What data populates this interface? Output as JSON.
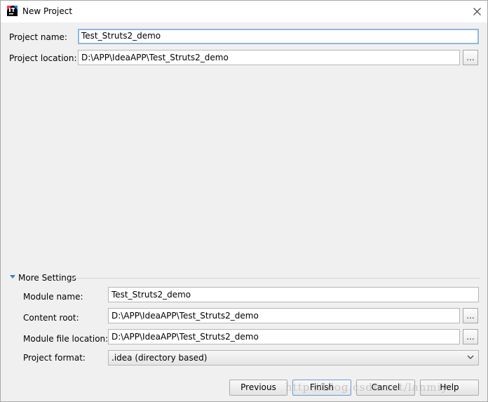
{
  "window": {
    "title": "New Project"
  },
  "project_name": {
    "label": "Project name:",
    "value": "Test_Struts2_demo"
  },
  "project_location": {
    "label": "Project location:",
    "value": "D:\\APP\\IdeaAPP\\Test_Struts2_demo",
    "browse": "..."
  },
  "more_settings": {
    "label": "More Settings"
  },
  "module_name": {
    "label": "Module name:",
    "value": "Test_Struts2_demo"
  },
  "content_root": {
    "label": "Content root:",
    "value": "D:\\APP\\IdeaAPP\\Test_Struts2_demo",
    "browse": "..."
  },
  "module_file_location": {
    "label": "Module file location:",
    "value": "D:\\APP\\IdeaAPP\\Test_Struts2_demo",
    "browse": "..."
  },
  "project_format": {
    "label": "Project format:",
    "value": ".idea (directory based)"
  },
  "buttons": {
    "previous": "Previous",
    "finish": "Finish",
    "cancel": "Cancel",
    "help": "Help"
  },
  "watermark": "http://blog.csdn.net/lanmiy"
}
